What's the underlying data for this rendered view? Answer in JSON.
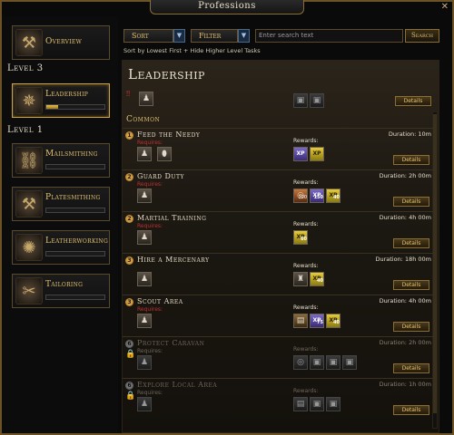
{
  "window": {
    "title": "Professions",
    "close": "✕"
  },
  "sidebar": {
    "overview": "Overview",
    "level3": "Level 3",
    "level1": "Level 1",
    "items": [
      {
        "label": "Leadership",
        "progress": 0.2
      },
      {
        "label": "Mailsmithing",
        "progress": 0.0
      },
      {
        "label": "Platesmithing",
        "progress": 0.0
      },
      {
        "label": "Leatherworking",
        "progress": 0.0
      },
      {
        "label": "Tailoring",
        "progress": 0.0
      }
    ]
  },
  "controls": {
    "sort": "Sort",
    "filter": "Filter",
    "search_placeholder": "Enter search text",
    "search_button": "Search",
    "sort_note": "Sort by Lowest First + Hide Higher Level Tasks"
  },
  "content": {
    "title": "Leadership",
    "common": "Common",
    "details": "Details",
    "requires": "Requires:",
    "rewards": "Rewards:",
    "tasks": [
      {
        "rank": "1",
        "name": "Feed the Needy",
        "duration": "Duration: 10m",
        "locked": false,
        "rewards": [
          "xp",
          "xp"
        ]
      },
      {
        "rank": "2",
        "name": "Guard Duty",
        "duration": "Duration: 2h 00m",
        "locked": false,
        "rewards": [
          "100",
          "150",
          "40"
        ]
      },
      {
        "rank": "2",
        "name": "Martial Training",
        "duration": "Duration: 4h 00m",
        "locked": false,
        "rewards": [
          "60"
        ]
      },
      {
        "rank": "3",
        "name": "Hire a Mercenary",
        "duration": "Duration: 18h 00m",
        "locked": false,
        "rewards": [
          "40"
        ]
      },
      {
        "rank": "3",
        "name": "Scout Area",
        "duration": "Duration: 4h 00m",
        "locked": false,
        "rewards": [
          "",
          "75",
          "40"
        ]
      },
      {
        "rank": "6",
        "name": "Protect Caravan",
        "duration": "Duration: 2h 00m",
        "locked": true,
        "rewards": [
          "",
          "",
          "",
          ""
        ]
      },
      {
        "rank": "6",
        "name": "Explore Local Area",
        "duration": "Duration: 1h 00m",
        "locked": true,
        "rewards": [
          "",
          "",
          ""
        ]
      }
    ]
  }
}
